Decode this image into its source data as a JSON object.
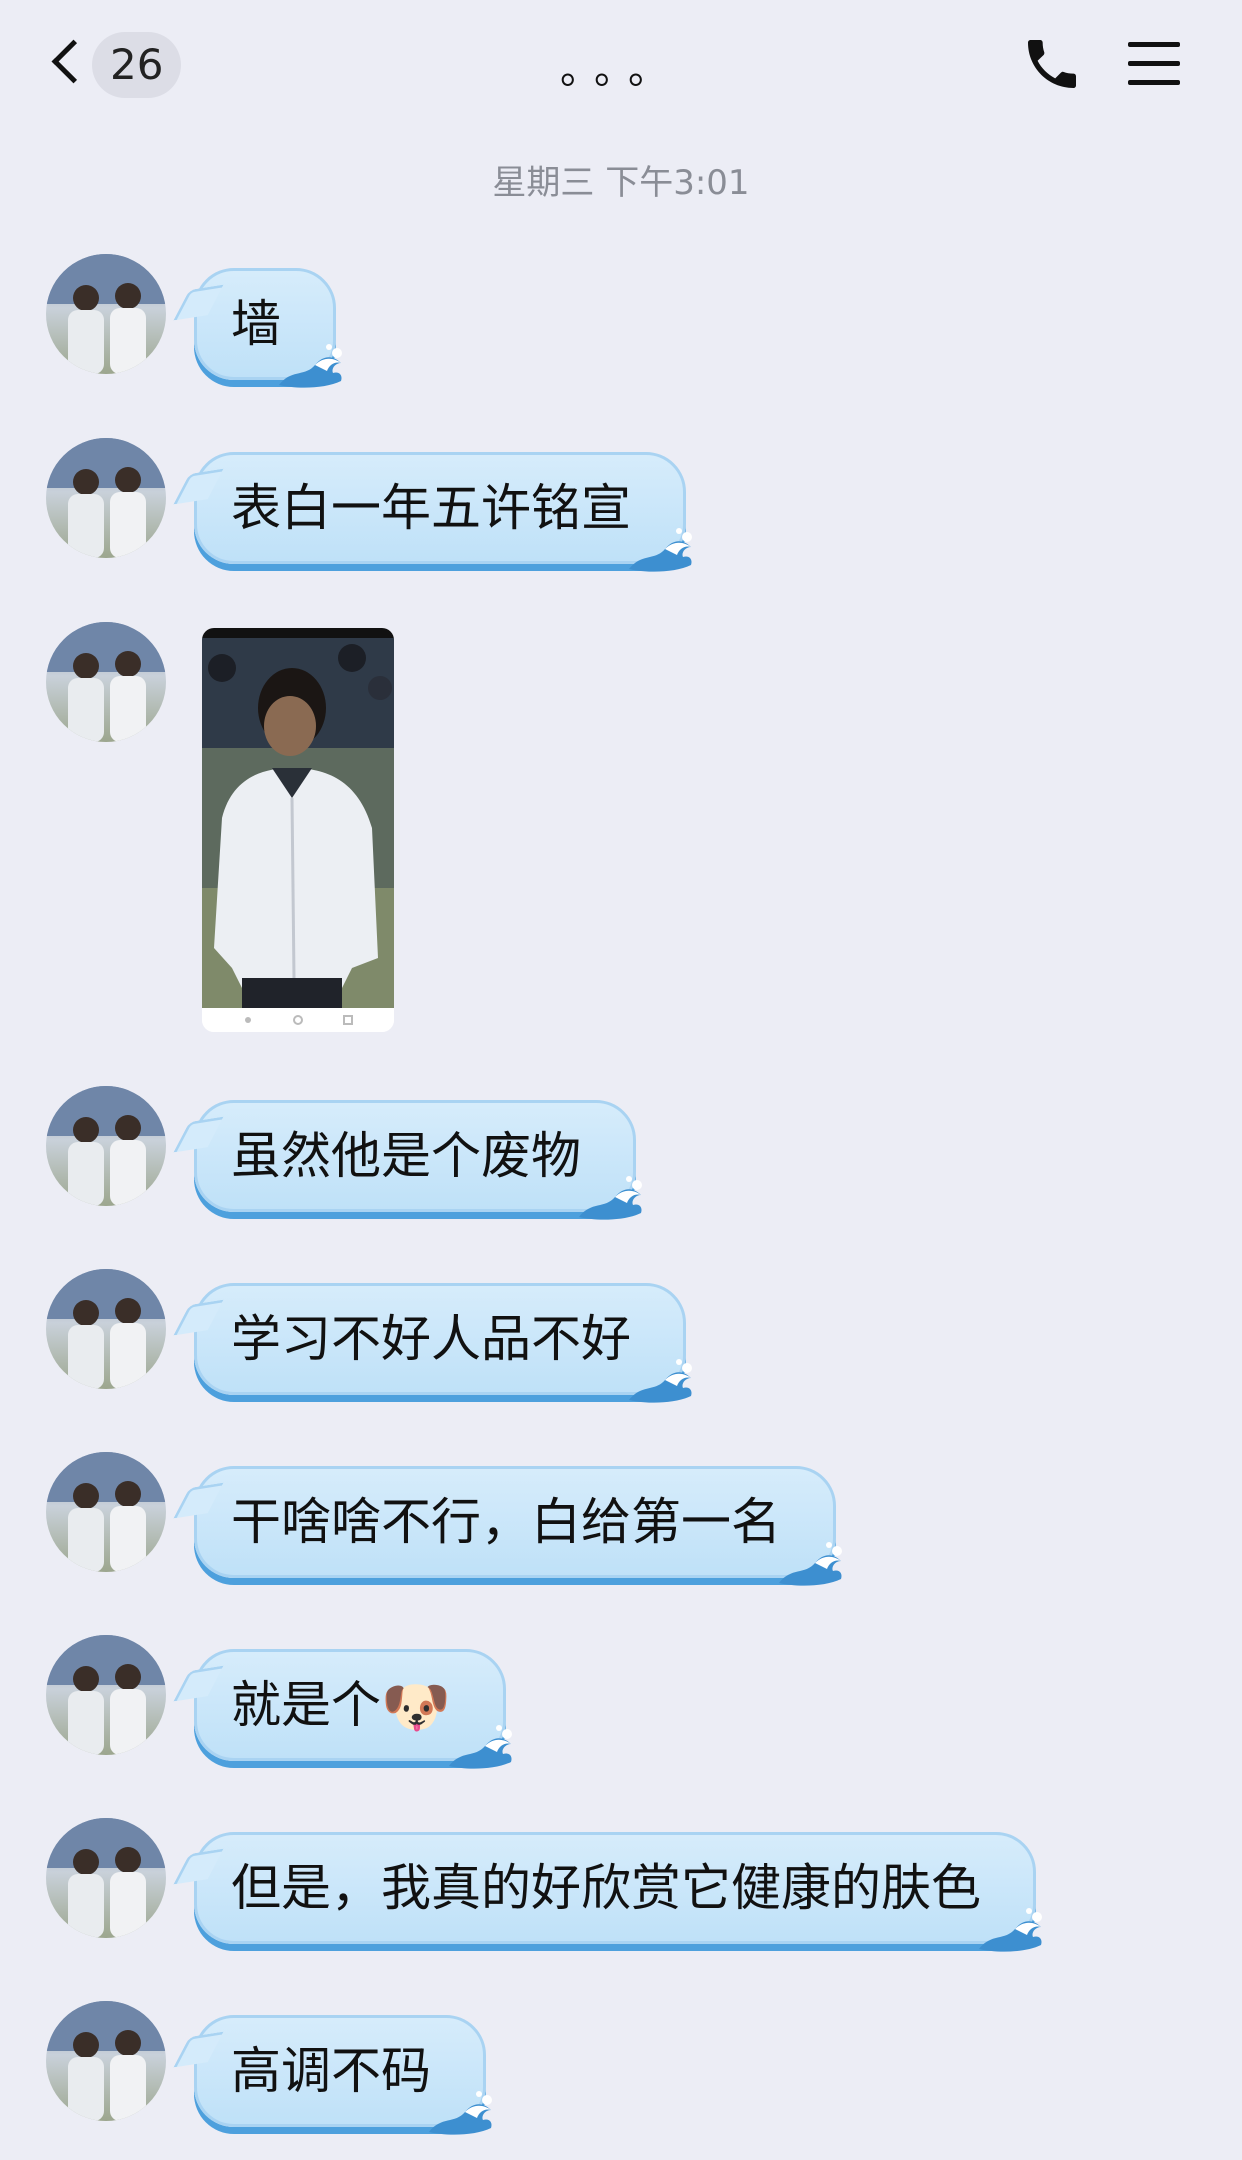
{
  "header": {
    "unread_count": "26",
    "title": "。。。"
  },
  "timestamp": "星期三 下午3:01",
  "messages": [
    {
      "type": "text",
      "text": "墙"
    },
    {
      "type": "text",
      "text": "表白一年五许铭宣"
    },
    {
      "type": "image"
    },
    {
      "type": "text",
      "text": "虽然他是个废物"
    },
    {
      "type": "text",
      "text": "学习不好人品不好"
    },
    {
      "type": "text",
      "text": "干啥啥不行，白给第一名"
    },
    {
      "type": "text_emoji",
      "text": "就是个",
      "emoji": "🐶",
      "emoji_name": "dog-face-emoji"
    },
    {
      "type": "text",
      "text": "但是，我真的好欣赏它健康的肤色"
    },
    {
      "type": "text",
      "text": "高调不码"
    }
  ],
  "icons": {
    "back": "chevron-left-icon",
    "call": "phone-icon",
    "menu": "hamburger-menu-icon",
    "bubble_decoration": "wave-icon"
  },
  "colors": {
    "background": "#ecedf5",
    "bubble_fill": "#c8e6fa",
    "bubble_border": "#a9d3f2",
    "bubble_shadow": "#4da0dd",
    "timestamp_text": "#8a8d96"
  }
}
